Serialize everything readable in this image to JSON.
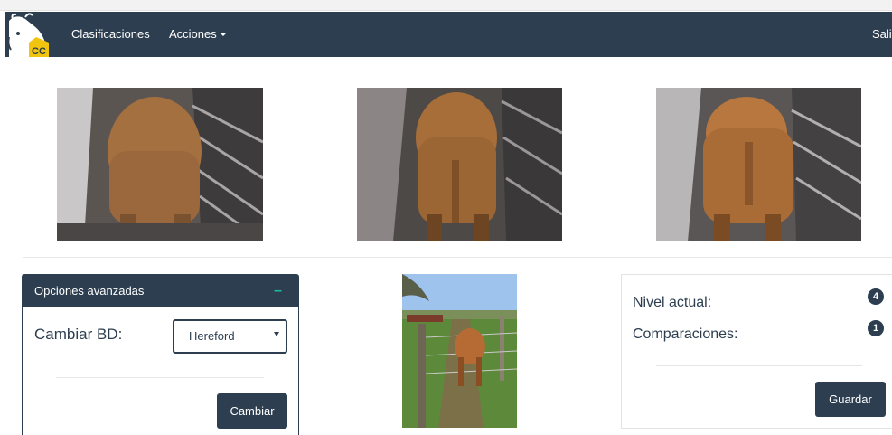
{
  "navbar": {
    "logo_text": "CC",
    "items": [
      {
        "label": "Clasificaciones"
      },
      {
        "label": "Acciones"
      }
    ],
    "logout_label": "Sali"
  },
  "photos": [
    {
      "name": "cow-rear-photo-1"
    },
    {
      "name": "cow-rear-photo-2"
    },
    {
      "name": "cow-rear-photo-3"
    },
    {
      "name": "cow-field-photo"
    }
  ],
  "advanced_panel": {
    "title": "Opciones avanzadas",
    "collapse_symbol": "–",
    "db_label": "Cambiar BD:",
    "db_selected": "Hereford",
    "change_button": "Cambiar"
  },
  "stats_panel": {
    "level_label": "Nivel actual:",
    "level_value": "4",
    "comparisons_label": "Comparaciones:",
    "comparisons_value": "1",
    "save_button": "Guardar"
  },
  "colors": {
    "primary": "#2c3e50",
    "accent": "#18bc9c"
  }
}
